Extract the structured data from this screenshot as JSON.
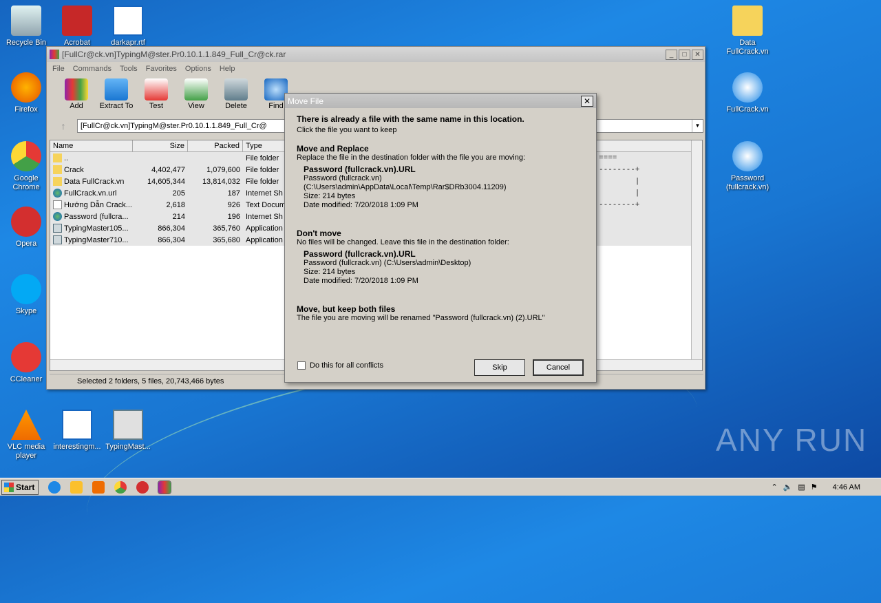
{
  "desktop": {
    "icons_left": [
      {
        "label": "Recycle Bin",
        "icon": "recycle-bin-icon"
      },
      {
        "label": "Acrobat",
        "icon": "acrobat-icon"
      },
      {
        "label": "darkapr.rtf",
        "icon": "word-doc-icon"
      },
      {
        "label": "Firefox",
        "icon": "firefox-icon"
      },
      {
        "label": "Google Chrome",
        "icon": "chrome-icon"
      },
      {
        "label": "Opera",
        "icon": "opera-icon"
      },
      {
        "label": "Skype",
        "icon": "skype-icon"
      },
      {
        "label": "CCleaner",
        "icon": "ccleaner-icon"
      },
      {
        "label": "VLC media player",
        "icon": "vlc-icon"
      },
      {
        "label": "interestingm...",
        "icon": "word-doc-icon"
      },
      {
        "label": "TypingMast...",
        "icon": "app-icon"
      }
    ],
    "icons_right": [
      {
        "label": "Data FullCrack.vn",
        "icon": "folder-icon"
      },
      {
        "label": "FullCrack.vn",
        "icon": "info-icon"
      },
      {
        "label": "Password (fullcrack.vn)",
        "icon": "info-icon"
      }
    ],
    "watermark": "ANY RUN"
  },
  "winrar": {
    "title": "[FullCr@ck.vn]TypingM@ster.Pr0.10.1.1.849_Full_Cr@ck.rar",
    "menu": [
      "File",
      "Commands",
      "Tools",
      "Favorites",
      "Options",
      "Help"
    ],
    "toolbar": [
      "Add",
      "Extract To",
      "Test",
      "View",
      "Delete",
      "Find"
    ],
    "address": "[FullCr@ck.vn]TypingM@ster.Pr0.10.1.1.849_Full_Cr@",
    "columns": [
      "Name",
      "Size",
      "Packed",
      "Type"
    ],
    "rows": [
      {
        "name": "..",
        "size": "",
        "packed": "",
        "type": "File folder",
        "icon": "folder"
      },
      {
        "name": "Crack",
        "size": "4,402,477",
        "packed": "1,079,600",
        "type": "File folder",
        "icon": "folder"
      },
      {
        "name": "Data FullCrack.vn",
        "size": "14,605,344",
        "packed": "13,814,032",
        "type": "File folder",
        "icon": "folder"
      },
      {
        "name": "FullCrack.vn.url",
        "size": "205",
        "packed": "187",
        "type": "Internet Sh",
        "icon": "url"
      },
      {
        "name": "Hướng Dẫn Crack...",
        "size": "2,618",
        "packed": "926",
        "type": "Text Docum",
        "icon": "txt"
      },
      {
        "name": "Password (fullcra...",
        "size": "214",
        "packed": "196",
        "type": "Internet Sh",
        "icon": "url"
      },
      {
        "name": "TypingMaster105...",
        "size": "866,304",
        "packed": "365,760",
        "type": "Application",
        "icon": "app"
      },
      {
        "name": "TypingMaster710...",
        "size": "866,304",
        "packed": "365,680",
        "type": "Application",
        "icon": "app"
      }
    ],
    "comment_lines": [
      "====",
      "--------+",
      "        |",
      "        |",
      "--------+"
    ],
    "status": "Selected 2 folders, 5 files, 20,743,466 bytes"
  },
  "dialog": {
    "title": "Move File",
    "heading": "There is already a file with the same name in this location.",
    "subheading": "Click the file you want to keep",
    "opt1": {
      "title": "Move and Replace",
      "desc": "Replace the file in the destination folder with the file you are moving:",
      "file": "Password (fullcrack.vn).URL",
      "name": "Password (fullcrack.vn)",
      "path": "(C:\\Users\\admin\\AppData\\Local\\Temp\\Rar$DRb3004.11209)",
      "size": "Size: 214 bytes",
      "date": "Date modified: 7/20/2018 1:09 PM"
    },
    "opt2": {
      "title": "Don't move",
      "desc": "No files will be changed. Leave this file in the destination folder:",
      "file": "Password (fullcrack.vn).URL",
      "name": "Password (fullcrack.vn) (C:\\Users\\admin\\Desktop)",
      "size": "Size: 214 bytes",
      "date": "Date modified: 7/20/2018 1:09 PM"
    },
    "opt3": {
      "title": "Move, but keep both files",
      "desc": "The file you are moving will be renamed \"Password (fullcrack.vn) (2).URL\""
    },
    "checkbox": "Do this for all conflicts",
    "skip": "Skip",
    "cancel": "Cancel"
  },
  "taskbar": {
    "start": "Start",
    "time": "4:46 AM"
  }
}
